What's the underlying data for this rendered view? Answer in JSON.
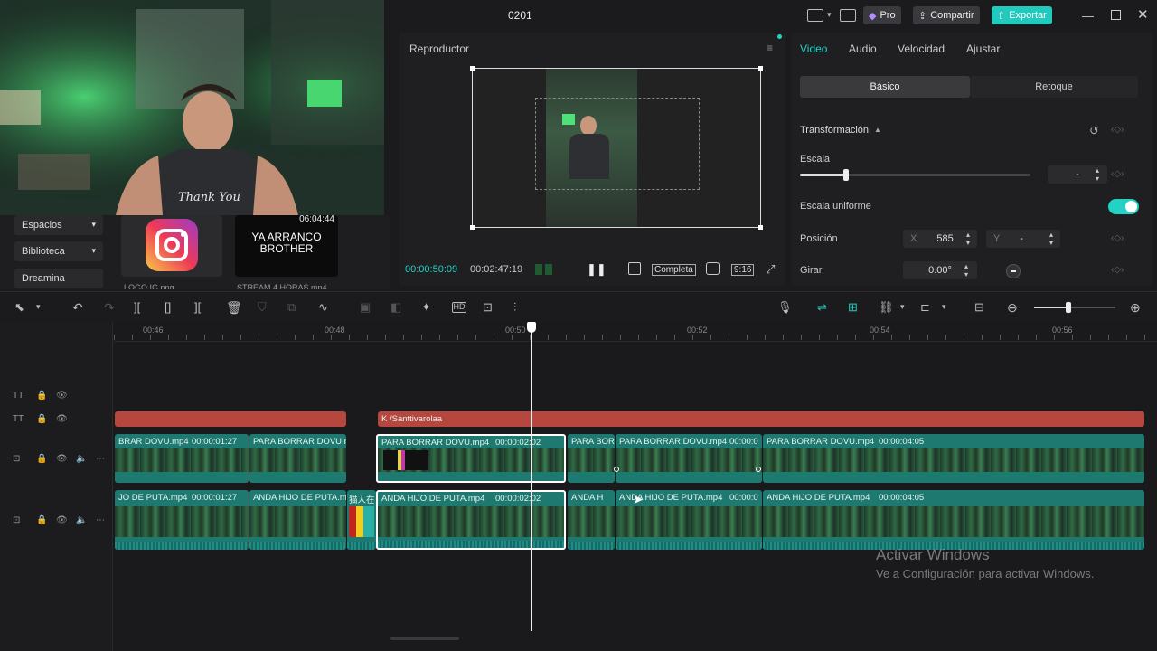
{
  "window": {
    "title": "0201",
    "pro_label": "Pro",
    "share_label": "Compartir",
    "export_label": "Exportar"
  },
  "media": {
    "nav": [
      "Espacios",
      "Biblioteca",
      "Dreamina"
    ],
    "cards": [
      {
        "caption": "LOGO IG.png"
      },
      {
        "text": "YA ARRANCO\nBROTHER",
        "duration": "06:04:44",
        "caption": "STREAM 4 HORAS.mp4"
      }
    ]
  },
  "player": {
    "title": "Reproductor",
    "current_time": "00:00:50:09",
    "total_time": "00:02:47:19",
    "quality_label": "Completa",
    "ratio_label": "9:16"
  },
  "inspector": {
    "tabs": [
      "Video",
      "Audio",
      "Velocidad",
      "Ajustar"
    ],
    "active_tab": "Video",
    "subtabs": [
      "Básico",
      "Retoque"
    ],
    "section_title": "Transformación",
    "scale_label": "Escala",
    "scale_value": "-",
    "scale_level": 0.2,
    "uniform_label": "Escala uniforme",
    "uniform_on": true,
    "position_label": "Posición",
    "pos_x_label": "X",
    "pos_x": "585",
    "pos_y_label": "Y",
    "pos_y": "-",
    "rotate_label": "Girar",
    "rotate_value": "0.00°"
  },
  "timeline": {
    "ruler": [
      "00:46",
      "00:48",
      "00:50",
      "00:52",
      "00:54",
      "00:56"
    ],
    "zoom_level": 0.42,
    "text_track": [
      {
        "label": ""
      },
      {
        "label": "K /Santtivarolaa"
      }
    ],
    "video_track": [
      {
        "name": "BRAR DOVU.mp4",
        "dur": "00:00:01:27"
      },
      {
        "name": "PARA BORRAR DOVU.mp4",
        "dur": ""
      },
      {
        "name": "PARA BORRAR DOVU.mp4",
        "dur": "00:00:02:02"
      },
      {
        "name": "PARA BOR",
        "dur": ""
      },
      {
        "name": "PARA BORRAR DOVU.mp4",
        "dur": "00:00:0"
      },
      {
        "name": "PARA BORRAR DOVU.mp4",
        "dur": "00:00:04:05"
      }
    ],
    "audio_track": [
      {
        "name": "JO DE PUTA.mp4",
        "dur": "00:00:01:27"
      },
      {
        "name": "ANDA HIJO DE PUTA.m",
        "dur": ""
      },
      {
        "name": "猫人在",
        "dur": ""
      },
      {
        "name": "ANDA HIJO DE PUTA.mp4",
        "dur": "00:00:02:02"
      },
      {
        "name": "ANDA H",
        "dur": ""
      },
      {
        "name": "ANDA HIJO DE PUTA.mp4",
        "dur": "00:00:0"
      },
      {
        "name": "ANDA HIJO DE PUTA.mp4",
        "dur": "00:00:04:05"
      }
    ]
  },
  "watermark": {
    "title": "Activar Windows",
    "subtitle": "Ve a Configuración para activar Windows."
  },
  "colors": {
    "accent": "#22d3c5",
    "clip_teal": "#1e7a70",
    "text_clip": "#b5473f"
  }
}
